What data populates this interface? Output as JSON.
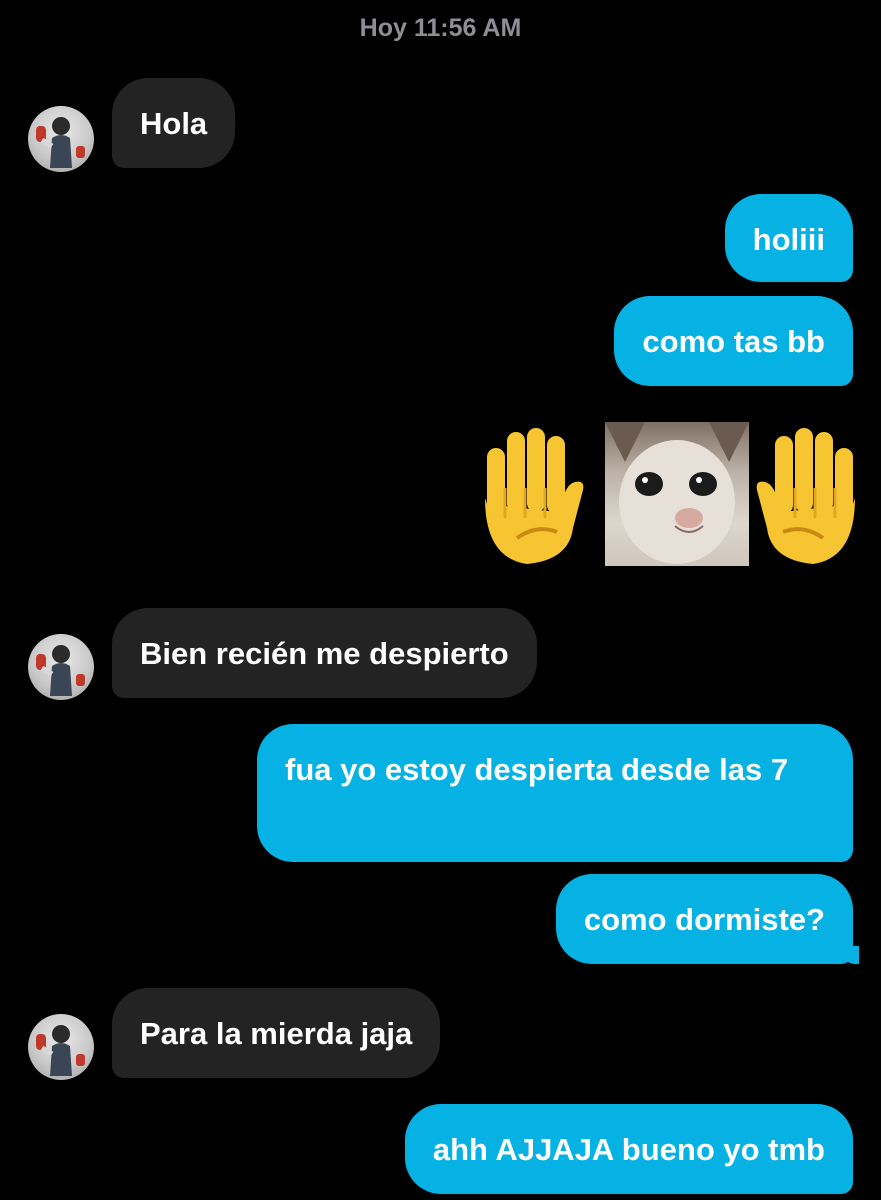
{
  "chat": {
    "timestamp": "Hoy 11:56 AM",
    "messages": [
      {
        "sender": "them",
        "text": "Hola"
      },
      {
        "sender": "me",
        "text": "holiii"
      },
      {
        "sender": "me",
        "text": "como tas bb"
      },
      {
        "sender": "me",
        "type": "sticker",
        "icon": "raised-hands-cat-sticker"
      },
      {
        "sender": "them",
        "text": "Bien recién me despierto"
      },
      {
        "sender": "me",
        "text": "fua yo estoy despierta desde las 7"
      },
      {
        "sender": "me",
        "text": "como dormiste?"
      },
      {
        "sender": "them",
        "text": "Para la mierda jaja"
      },
      {
        "sender": "me",
        "text": "ahh AJJAJA bueno yo tmb"
      }
    ]
  },
  "colors": {
    "background": "#000000",
    "incoming_bubble": "#232323",
    "outgoing_bubble": "#06b2e3",
    "timestamp_text": "#8e8e93"
  }
}
